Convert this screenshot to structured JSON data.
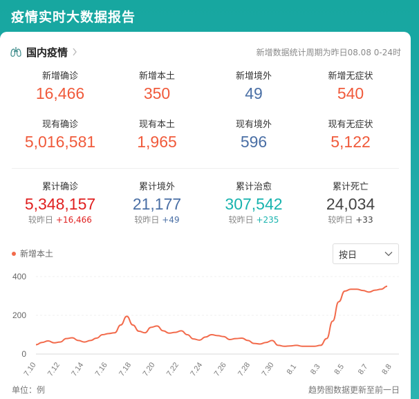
{
  "header": {
    "title": "疫情实时大数据报告"
  },
  "section": {
    "title": "国内疫情",
    "period_note": "新增数据统计周期为昨日08.08 0-24时"
  },
  "row1": [
    {
      "label": "新增确诊",
      "value": "16,466",
      "color": "#f05a3b"
    },
    {
      "label": "新增本土",
      "value": "350",
      "color": "#f05a3b"
    },
    {
      "label": "新增境外",
      "value": "49",
      "color": "#4a6fa5"
    },
    {
      "label": "新增无症状",
      "value": "540",
      "color": "#f05a3b"
    }
  ],
  "row2": [
    {
      "label": "现有确诊",
      "value": "5,016,581",
      "color": "#f05a3b"
    },
    {
      "label": "现有本土",
      "value": "1,965",
      "color": "#f05a3b"
    },
    {
      "label": "现有境外",
      "value": "596",
      "color": "#4a6fa5"
    },
    {
      "label": "现有无症状",
      "value": "5,122",
      "color": "#f05a3b"
    }
  ],
  "row3": [
    {
      "label": "累计确诊",
      "value": "5,348,157",
      "color": "#e02020",
      "delta_prefix": "较昨日",
      "delta": "+16,466",
      "delta_color": "#e02020"
    },
    {
      "label": "累计境外",
      "value": "21,177",
      "color": "#4a6fa5",
      "delta_prefix": "较昨日",
      "delta": "+49",
      "delta_color": "#4a6fa5"
    },
    {
      "label": "累计治愈",
      "value": "307,542",
      "color": "#18b3ae",
      "delta_prefix": "较昨日",
      "delta": "+235",
      "delta_color": "#18b3ae"
    },
    {
      "label": "累计死亡",
      "value": "24,034",
      "color": "#444444",
      "delta_prefix": "较昨日",
      "delta": "+33",
      "delta_color": "#444444"
    }
  ],
  "legend": {
    "label": "新增本土",
    "color": "#f26a4b"
  },
  "select": {
    "value": "按日"
  },
  "footer": {
    "unit": "单位：例",
    "note": "趋势图数据更新至前一日"
  },
  "chart_data": {
    "type": "line",
    "series": [
      {
        "name": "新增本土",
        "values": [
          48,
          60,
          68,
          58,
          62,
          80,
          84,
          70,
          62,
          70,
          82,
          100,
          106,
          110,
          150,
          195,
          150,
          118,
          110,
          138,
          145,
          120,
          108,
          112,
          120,
          100,
          78,
          72,
          88,
          100,
          95,
          90,
          75,
          80,
          82,
          70,
          55,
          52,
          60,
          70,
          45,
          40,
          42,
          45,
          40,
          40,
          40,
          45,
          80,
          170,
          270,
          325,
          335,
          335,
          328,
          320,
          330,
          335,
          350
        ]
      }
    ],
    "x_tick_labels": [
      "7.10",
      "7.12",
      "7.14",
      "7.16",
      "7.18",
      "7.20",
      "7.22",
      "7.24",
      "7.26",
      "7.28",
      "7.30",
      "8.1",
      "8.3",
      "8.5",
      "8.7",
      "8.8"
    ],
    "y_ticks": [
      0,
      200,
      400
    ],
    "ylim": [
      0,
      400
    ],
    "color": "#f26a4b",
    "grid": true
  }
}
